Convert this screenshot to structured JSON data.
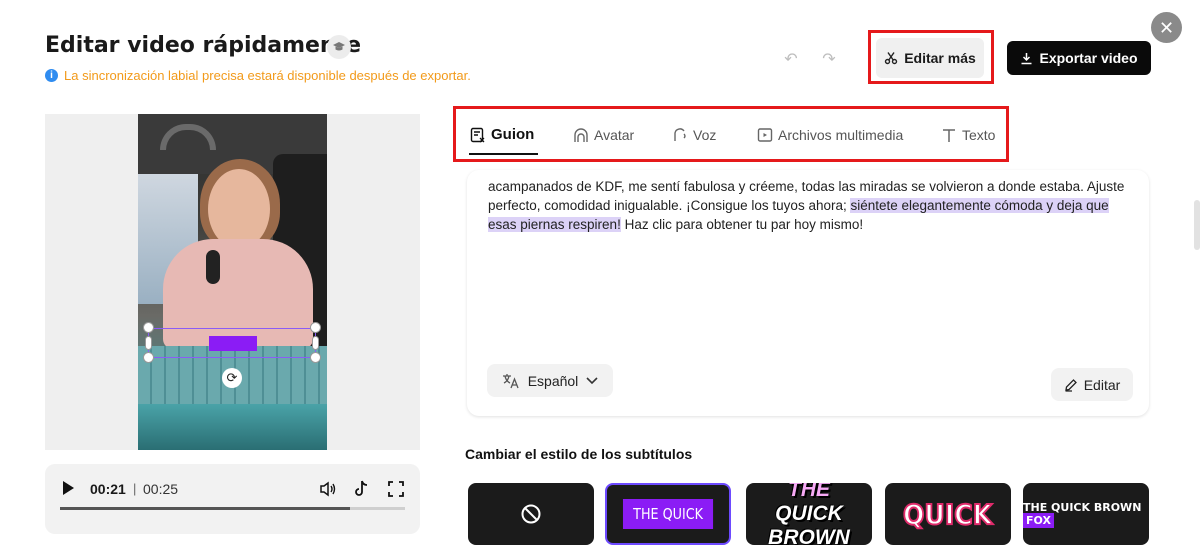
{
  "header": {
    "title": "Editar video rápidamente",
    "notice": "La sincronización labial precisa estará disponible después de exportar.",
    "edit_more_label": "Editar más",
    "export_label": "Exportar video"
  },
  "tabs": [
    {
      "label": "Guion",
      "icon": "script-icon",
      "active": true
    },
    {
      "label": "Avatar",
      "icon": "avatar-icon",
      "active": false
    },
    {
      "label": "Voz",
      "icon": "voice-icon",
      "active": false
    },
    {
      "label": "Archivos multimedia",
      "icon": "media-icon",
      "active": false
    },
    {
      "label": "Texto",
      "icon": "text-icon",
      "active": false
    }
  ],
  "script": {
    "text_before": "acampanados de KDF, me sentí fabulosa y créeme, todas las miradas se volvieron a donde estaba. Ajuste perfecto, comodidad inigualable. ¡Consigue los tuyos ahora; ",
    "text_highlighted": "siéntete elegantemente cómoda y deja que esas piernas respiren!",
    "text_after": " Haz clic para obtener tu par hoy mismo!",
    "language_label": "Español",
    "edit_label": "Editar"
  },
  "player": {
    "current_time": "00:21",
    "separator": "|",
    "total_time": "00:25",
    "progress": 0.84
  },
  "subtitle_styles": {
    "title": "Cambiar el estilo de los subtítulos",
    "options": [
      {
        "name": "none",
        "icon": "no-style-icon"
      },
      {
        "name": "purple-box",
        "text": "THE QUICK",
        "selected": true
      },
      {
        "name": "stacked",
        "lines": [
          "THE",
          "QUICK",
          "BROWN"
        ]
      },
      {
        "name": "bold-outline",
        "text": "QUICK"
      },
      {
        "name": "small-highlight",
        "text": "THE QUICK BROWN",
        "accent": "FOX"
      }
    ]
  },
  "colors": {
    "accent": "#8b1cf5",
    "highlight": "#dcd2f7",
    "notice": "#f29a1a",
    "annotation_box": "#e5191b"
  }
}
